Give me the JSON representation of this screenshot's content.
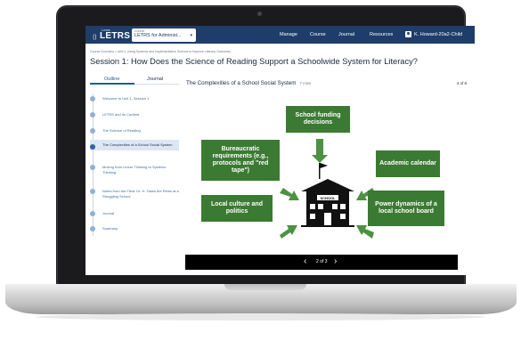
{
  "header": {
    "logo_small": "Lexia",
    "logo_text": "LETRS",
    "course_label": "Course",
    "course_value": "LETRS for Administ...",
    "nav": [
      "Manage",
      "Course",
      "Journal",
      "Resources"
    ],
    "user": "K. Howard-20a2-Child"
  },
  "breadcrumb": "Course Overview > Unit 1: Using Systems and Implementation Science to Improve Literacy Outcomes",
  "page_title": "Session 1:  How Does the Science of Reading Support a Schoolwide System for Literacy?",
  "sidebar": {
    "tabs": [
      "Outline",
      "Journal"
    ],
    "items": [
      {
        "label": "Welcome to Unit 1, Session 1"
      },
      {
        "label": "LETRS and Its Content"
      },
      {
        "label": "The Science of Reading"
      },
      {
        "label": "The Complexities of a School Social System",
        "active": true
      },
      {
        "label": "Moving from Linear Thinking to Systems Thinking"
      },
      {
        "label": "Notes from the Field: Dr. H. Takes the Reins at a Struggling School"
      },
      {
        "label": "Journal"
      },
      {
        "label": "Summary"
      }
    ]
  },
  "content": {
    "title": "The Complexities of a School Social System",
    "duration": "7 mins",
    "page": "4 of 8"
  },
  "diagram": {
    "center_label": "SCHOOL",
    "boxes": {
      "funding": "School funding decisions",
      "bureaucratic": "Bureaucratic requirements (e.g., protocols and \"red tape\")",
      "academic": "Academic calendar",
      "local_culture": "Local culture and politics",
      "power": "Power dynamics of a local school board"
    },
    "box_color": "#3b7a32",
    "arrow_color": "#4d9142"
  },
  "player": {
    "prev_icon": "chevron-left-icon",
    "next_icon": "chevron-right-icon",
    "count": "2 of 3"
  },
  "colors": {
    "header_bg": "#1e3d6b",
    "accent": "#1e5aa8",
    "active_item_bg": "#dbe7f4"
  }
}
